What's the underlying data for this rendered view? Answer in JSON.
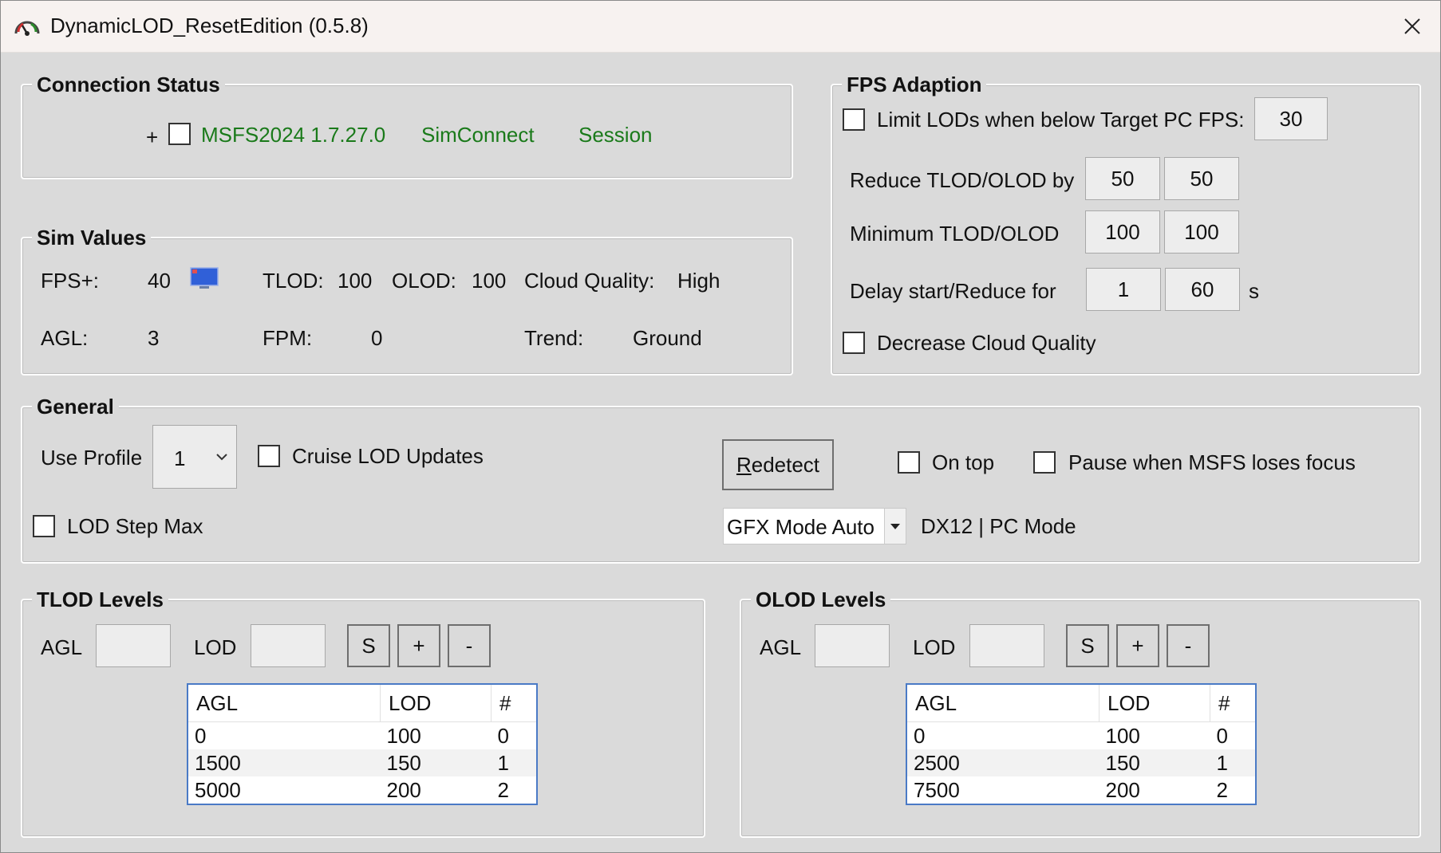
{
  "window": {
    "title": "DynamicLOD_ResetEdition (0.5.8)"
  },
  "connection": {
    "group_title": "Connection Status",
    "plus": "+",
    "msfs": "MSFS2024 1.7.27.0",
    "simconnect": "SimConnect",
    "session": "Session"
  },
  "simvalues": {
    "group_title": "Sim Values",
    "fps_label": "FPS+:",
    "fps_value": "40",
    "tlod_label": "TLOD:",
    "tlod_value": "100",
    "olod_label": "OLOD:",
    "olod_value": "100",
    "cloud_label": "Cloud Quality:",
    "cloud_value": "High",
    "agl_label": "AGL:",
    "agl_value": "3",
    "fpm_label": "FPM:",
    "fpm_value": "0",
    "trend_label": "Trend:",
    "trend_value": "Ground"
  },
  "fps": {
    "group_title": "FPS Adaption",
    "limit_label": "Limit LODs when below Target PC FPS:",
    "target_fps": "30",
    "reduce_label": "Reduce TLOD/OLOD by",
    "reduce_tlod": "50",
    "reduce_olod": "50",
    "min_label": "Minimum TLOD/OLOD",
    "min_tlod": "100",
    "min_olod": "100",
    "delay_label": "Delay start/Reduce for",
    "delay_start": "1",
    "delay_reduce": "60",
    "delay_unit": "s",
    "decrease_cloud_label": "Decrease Cloud Quality"
  },
  "general": {
    "group_title": "General",
    "use_profile_label": "Use Profile",
    "profile_value": "1",
    "cruise_label": "Cruise LOD Updates",
    "redetect_underline": "R",
    "redetect_rest": "edetect",
    "ontop_label": "On top",
    "pause_label": "Pause when MSFS loses focus",
    "lodstep_label": "LOD Step Max",
    "gfx_mode": "GFX Mode Auto",
    "gfx_status": "DX12 | PC Mode"
  },
  "tlod": {
    "group_title": "TLOD Levels",
    "agl_label": "AGL",
    "lod_label": "LOD",
    "s_button": "S",
    "plus_button": "+",
    "minus_button": "-",
    "headers": [
      "AGL",
      "LOD",
      "#"
    ],
    "rows": [
      [
        "0",
        "100",
        "0"
      ],
      [
        "1500",
        "150",
        "1"
      ],
      [
        "5000",
        "200",
        "2"
      ]
    ]
  },
  "olod": {
    "group_title": "OLOD Levels",
    "agl_label": "AGL",
    "lod_label": "LOD",
    "s_button": "S",
    "plus_button": "+",
    "minus_button": "-",
    "headers": [
      "AGL",
      "LOD",
      "#"
    ],
    "rows": [
      [
        "0",
        "100",
        "0"
      ],
      [
        "2500",
        "150",
        "1"
      ],
      [
        "7500",
        "200",
        "2"
      ]
    ]
  },
  "colors": {
    "status_green": "#1a7a1a",
    "table_border": "#4a7ac6",
    "window_bg": "#dadada"
  }
}
